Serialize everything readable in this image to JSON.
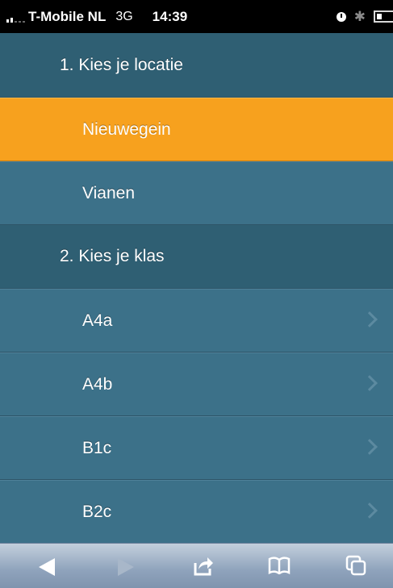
{
  "status_bar": {
    "carrier": "T-Mobile NL",
    "network": "3G",
    "time": "14:39",
    "icons": [
      "signal-icon",
      "clock-icon",
      "bluetooth-icon",
      "battery-icon"
    ]
  },
  "sections": [
    {
      "header": "1. Kies je locatie",
      "items": [
        {
          "label": "Nieuwegein",
          "selected": true
        },
        {
          "label": "Vianen",
          "selected": false
        }
      ]
    },
    {
      "header": "2. Kies je klas",
      "items": [
        {
          "label": "A4a",
          "chevron": true
        },
        {
          "label": "A4b",
          "chevron": true
        },
        {
          "label": "B1c",
          "chevron": true
        },
        {
          "label": "B2c",
          "chevron": true
        }
      ]
    }
  ],
  "toolbar": {
    "buttons": [
      "back-icon",
      "forward-icon",
      "share-icon",
      "bookmarks-icon",
      "tabs-icon"
    ]
  },
  "colors": {
    "header_bg": "#2f5f73",
    "item_bg": "#3c7189",
    "selected_bg": "#f7a11e",
    "text": "#ffffff"
  }
}
